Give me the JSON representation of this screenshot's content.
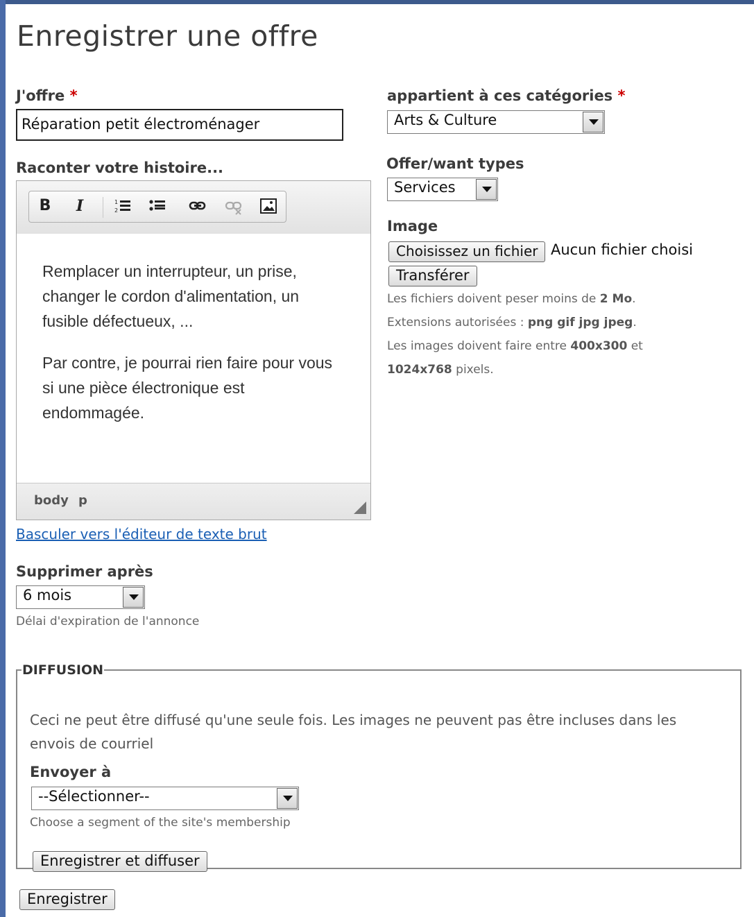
{
  "page": {
    "title": "Enregistrer une offre"
  },
  "offer_field": {
    "label": "J'offre",
    "required_mark": "*",
    "value": "Réparation petit électroménager"
  },
  "story": {
    "label": "Raconter votre histoire...",
    "toolbar": [
      {
        "name": "bold-icon",
        "glyph": "B"
      },
      {
        "name": "italic-icon",
        "glyph": "I"
      },
      {
        "name": "numbered-list-icon",
        "glyph": "⒈"
      },
      {
        "name": "bullet-list-icon",
        "glyph": "•"
      },
      {
        "name": "link-icon",
        "glyph": "⊖"
      },
      {
        "name": "unlink-icon",
        "glyph": "⊘"
      },
      {
        "name": "image-icon",
        "glyph": "▨"
      }
    ],
    "paragraph1": "Remplacer un interrupteur, un prise, changer le cordon d'alimentation, un fusible défectueux, ...",
    "paragraph2": "Par contre, je pourrai rien faire pour vous si une pièce électronique est endommagée.",
    "status_body": "body",
    "status_p": "p"
  },
  "switch_link": "Basculer vers l'éditeur de texte brut",
  "delete_after": {
    "label": "Supprimer après",
    "selected": "6 mois",
    "help": "Délai d'expiration de l'annonce"
  },
  "categories": {
    "label": "appartient à ces catégories",
    "required_mark": "*",
    "selected": "Arts & Culture"
  },
  "types": {
    "label": "Offer/want types",
    "selected": "Services"
  },
  "image": {
    "label": "Image",
    "choose_button": "Choisissez un fichier",
    "no_file": "Aucun fichier choisi",
    "upload_button": "Transférer",
    "help_size_prefix": "Les fichiers doivent peser moins de",
    "help_size_value": "2 Mo",
    "help_ext_prefix": "Extensions autorisées :",
    "help_ext_value": "png gif jpg jpeg",
    "help_dim_prefix": "Les images doivent faire entre",
    "help_dim_min": "400x300",
    "help_dim_and": "et",
    "help_dim_max": "1024x768",
    "help_dim_suffix": "pixels."
  },
  "diffusion": {
    "legend": "DIFFUSION",
    "description": "Ceci ne peut être diffusé qu'une seule fois. Les images ne peuvent pas être incluses dans les envois de courriel",
    "send_to_label": "Envoyer à",
    "send_to_selected": "--Sélectionner--",
    "send_to_help": "Choose a segment of the site's membership",
    "save_and_broadcast_button": "Enregistrer et diffuser"
  },
  "save_button": "Enregistrer"
}
